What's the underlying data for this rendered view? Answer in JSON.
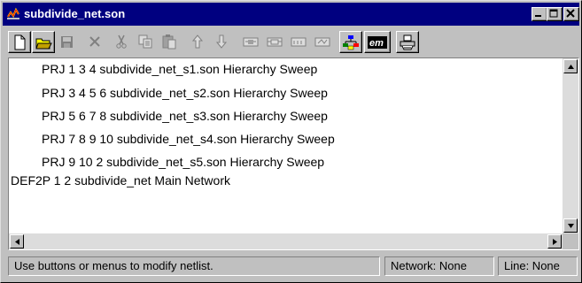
{
  "window": {
    "title": "subdivide_net.son",
    "controls": [
      "minimize-icon",
      "maximize-icon",
      "close-icon"
    ]
  },
  "toolbar": {
    "buttons": [
      {
        "name": "new-file-button",
        "icon": "new-document-icon",
        "enabled": true
      },
      {
        "name": "open-file-button",
        "icon": "open-folder-icon",
        "enabled": true
      },
      {
        "name": "save-button",
        "icon": "floppy-disk-icon",
        "enabled": false
      },
      {
        "name": "delete-button",
        "icon": "x-delete-icon",
        "enabled": false
      },
      {
        "name": "cut-button",
        "icon": "scissors-icon",
        "enabled": false
      },
      {
        "name": "copy-button",
        "icon": "copy-icon",
        "enabled": false
      },
      {
        "name": "paste-button",
        "icon": "paste-icon",
        "enabled": false
      },
      {
        "name": "move-up-button",
        "icon": "arrow-up-icon",
        "enabled": false
      },
      {
        "name": "move-down-button",
        "icon": "arrow-down-icon",
        "enabled": false
      },
      {
        "name": "add-element-button",
        "icon": "element-icon",
        "enabled": false
      },
      {
        "name": "add-project-button",
        "icon": "project-icon",
        "enabled": false
      },
      {
        "name": "add-port-button",
        "icon": "port-icon",
        "enabled": false
      },
      {
        "name": "add-network-button",
        "icon": "network-icon",
        "enabled": false
      },
      {
        "name": "hierarchy-button",
        "icon": "hierarchy-icon",
        "enabled": true
      },
      {
        "name": "em-button",
        "icon": "em-icon",
        "label": "em",
        "enabled": true
      },
      {
        "name": "print-button",
        "icon": "printer-icon",
        "enabled": true
      }
    ]
  },
  "netlist": {
    "lines": [
      {
        "text": "PRJ 1 3 4 subdivide_net_s1.son Hierarchy Sweep",
        "indent": true
      },
      {
        "text": "PRJ 3 4 5 6 subdivide_net_s2.son Hierarchy Sweep",
        "indent": true
      },
      {
        "text": "PRJ 5 6 7 8 subdivide_net_s3.son Hierarchy Sweep",
        "indent": true
      },
      {
        "text": "PRJ 7 8 9 10 subdivide_net_s4.son Hierarchy Sweep",
        "indent": true
      },
      {
        "text": "PRJ 9 10 2 subdivide_net_s5.son Hierarchy Sweep",
        "indent": true
      },
      {
        "text": "DEF2P 1 2 subdivide_net Main Network",
        "indent": false
      }
    ]
  },
  "statusbar": {
    "message": "Use buttons or menus to modify netlist.",
    "network": "Network: None",
    "line": "Line: None"
  },
  "colors": {
    "titlebar": "#000080",
    "face": "#c0c0c0",
    "content_bg": "#ffffff"
  }
}
